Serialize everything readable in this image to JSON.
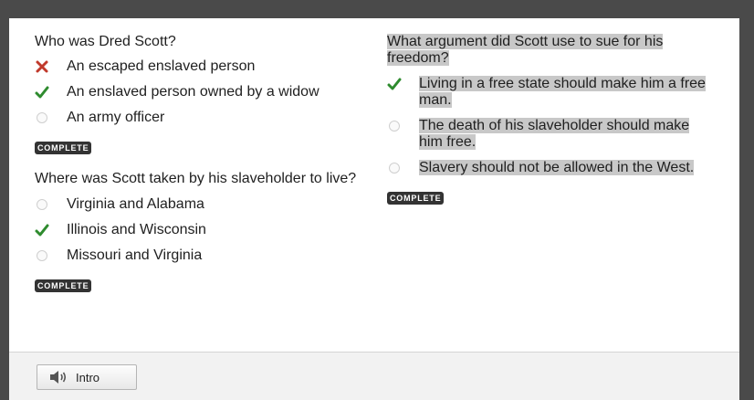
{
  "left": {
    "q1": {
      "question": "Who was Dred Scott?",
      "options": [
        {
          "label": "An escaped enslaved person",
          "state": "wrong",
          "icon": "x-icon"
        },
        {
          "label": "An enslaved person owned by a widow",
          "state": "correct",
          "icon": "check-icon"
        },
        {
          "label": "An army officer",
          "state": "unselected",
          "icon": "radio-icon"
        }
      ],
      "badge": "COMPLETE"
    },
    "q2": {
      "question": "Where was Scott taken by his slaveholder to live?",
      "options": [
        {
          "label": "Virginia and Alabama",
          "state": "unselected",
          "icon": "radio-icon"
        },
        {
          "label": "Illinois and Wisconsin",
          "state": "correct",
          "icon": "check-icon"
        },
        {
          "label": "Missouri and Virginia",
          "state": "unselected",
          "icon": "radio-icon"
        }
      ],
      "badge": "COMPLETE"
    }
  },
  "right": {
    "q3": {
      "question_line1": "What argument did Scott use to sue for his",
      "question_line2": "freedom?",
      "options": [
        {
          "line1": "Living in a free state should make him a free",
          "line2": "man.",
          "state": "correct",
          "icon": "check-icon"
        },
        {
          "line1": "The death of his slaveholder should make",
          "line2": "him free.",
          "state": "unselected",
          "icon": "radio-icon"
        },
        {
          "line1": "Slavery should not be allowed in the West.",
          "line2": "",
          "state": "unselected",
          "icon": "radio-icon"
        }
      ],
      "badge": "COMPLETE"
    }
  },
  "footer": {
    "intro_label": "Intro",
    "intro_icon": "speaker-icon"
  },
  "colors": {
    "correct": "#2e8b2e",
    "wrong": "#c0392b",
    "badge": "#333333",
    "highlight": "#c8c8c8"
  }
}
